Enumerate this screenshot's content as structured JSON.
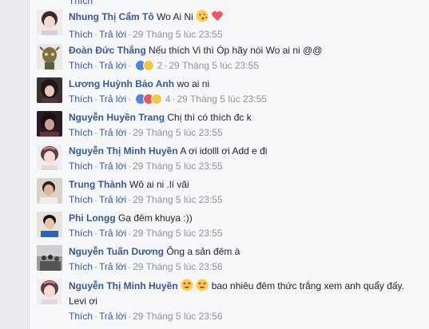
{
  "comments": [
    {
      "author": "Nhung Thị Cẩm Tô",
      "text": "Wo Ai Ni",
      "emojis": [
        "kiss-emoji",
        "heart-emoji"
      ],
      "like": "Thích",
      "reply": "Trả lời",
      "time": "29 Tháng 5 lúc 23:55",
      "reactions": null
    },
    {
      "author": "Đoàn Đức Thắng",
      "text": "Nếu thích Vi thì Óp hãy nói Wo ai ni @@",
      "like": "Thích",
      "reply": "Trả lời",
      "reactions": {
        "types": [
          "like",
          "haha"
        ],
        "count": "2"
      },
      "time": "29 Tháng 5 lúc 23:55"
    },
    {
      "author": "Lương Huỳnh Bảo Anh",
      "text": "wo ai ni",
      "like": "Thích",
      "reply": "Trả lời",
      "reactions": {
        "types": [
          "like",
          "heart",
          "haha"
        ],
        "count": "4"
      },
      "time": "29 Tháng 5 lúc 23:55"
    },
    {
      "author": "Nguyễn Huyền Trang",
      "text": "Chị thì có thích đc k",
      "like": "Thích",
      "reply": "Trả lời",
      "time": "29 Tháng 5 lúc 23:55"
    },
    {
      "author": "Nguyễn Thị Minh Huyền",
      "text": "A ơi idolll ơi Add e đi",
      "like": "Thích",
      "reply": "Trả lời",
      "time": "29 Tháng 5 lúc 23:55"
    },
    {
      "author": "Trung Thành",
      "text": "Wô ai ni .lí vãi",
      "like": "Thích",
      "reply": "Trả lời",
      "time": "29 Tháng 5 lúc 23:55"
    },
    {
      "author": "Phi Longg",
      "text": "Gạ đêm khuya :))",
      "like": "Thích",
      "reply": "Trả lời",
      "time": "29 Tháng 5 lúc 23:55"
    },
    {
      "author": "Nguyễn Tuấn Dương",
      "text": "Ông a sản đêm à",
      "like": "Thích",
      "reply": "Trả lời",
      "time": "29 Tháng 5 lúc 23:56"
    },
    {
      "author": "Nguyễn Thị Minh Huyền",
      "text": "bao nhiêu đêm thức trắng xem anh quẩy đấy. Levi ơi",
      "emojis_before": [
        "heart-eyes-emoji",
        "heart-eyes-emoji"
      ],
      "like": "Thích",
      "reply": "Trả lời",
      "time": "29 Tháng 5 lúc 23:56"
    }
  ],
  "top_stub": "Thích"
}
